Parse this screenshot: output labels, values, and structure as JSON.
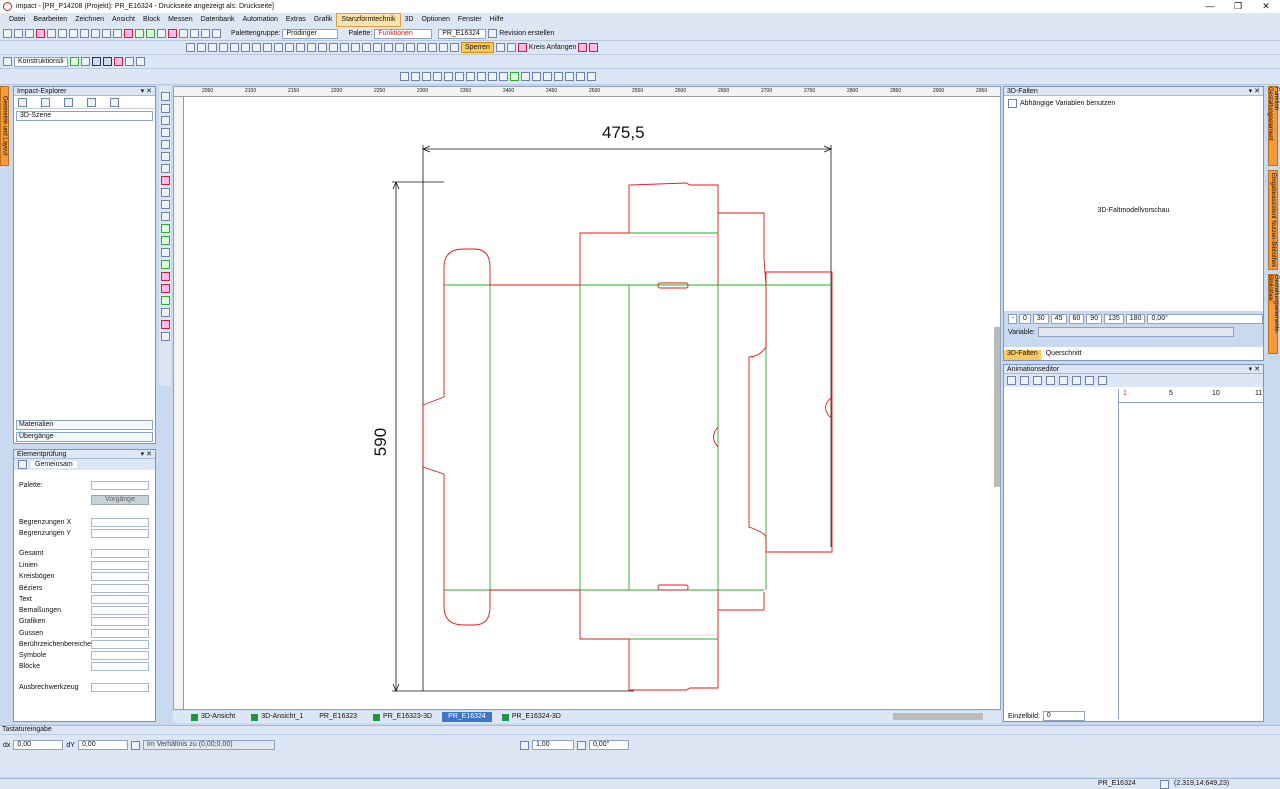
{
  "window": {
    "title": "impact - [PR_P14208 (Projekt): PR_E16324 - Druckseite angezeigt als: Druckseite]",
    "controls": [
      "—",
      "❐",
      "✕"
    ]
  },
  "menu": [
    "Datei",
    "Bearbeiten",
    "Zeichnen",
    "Ansicht",
    "Block",
    "Messen",
    "Datenbank",
    "Automation",
    "Extras",
    "Grafik",
    "Stanzformtechnik",
    "3D",
    "Optionen",
    "Fenster",
    "Hilfe"
  ],
  "menu_active": "Stanzformtechnik",
  "toolbar1": {
    "palettengruppe_label": "Palettengruppe:",
    "palettengruppe_value": "Prodinger",
    "palette_label": "Palette:",
    "palette_value": "Funktionen",
    "file_value": "PR_E16324",
    "revision_label": "Revision erstellen"
  },
  "toolbar2": {
    "sperren_label": "Sperren",
    "kreis_label": "Kreis Anfangen"
  },
  "toolbar3": {
    "layer_value": "Konstruktionsli"
  },
  "left_tab": "Geometrie und Layout",
  "explorer": {
    "title": "Impact-Explorer",
    "scene_value": "3D-Szene",
    "materialien": "Materialien",
    "uebergaenge": "Übergänge"
  },
  "element": {
    "title": "Elementprüfung",
    "tab": "Gemeinsam",
    "palette_label": "Palette:",
    "vorgaenge_label": "Vorgänge",
    "rows1": [
      "Begrenzungen X",
      "Begrenzungen Y"
    ],
    "rows2": [
      "Gesamt",
      "Linien",
      "Kreisbögen",
      "Béziers",
      "Text",
      "Bemaßungen",
      "Grafiken",
      "Gussen",
      "Berührzeichenbereiche",
      "Symbole",
      "Blöcke"
    ],
    "ausbrech": "Ausbrechwerkzeug"
  },
  "ruler_ticks": [
    "2050",
    "2100",
    "2150",
    "2200",
    "2250",
    "2300",
    "2350",
    "2400",
    "2450",
    "2500",
    "2550",
    "2600",
    "2650",
    "2700",
    "2750",
    "2800",
    "2850",
    "2900",
    "2950",
    "3000"
  ],
  "drawing": {
    "width_dim": "475,5",
    "height_dim": "590"
  },
  "tabs": [
    {
      "label": "3D-Ansicht",
      "active": false
    },
    {
      "label": "3D-Ansicht_1",
      "active": false
    },
    {
      "label": "PR_E16323",
      "active": false
    },
    {
      "label": "PR_E16323-3D",
      "active": false
    },
    {
      "label": "PR_E16324",
      "active": true
    },
    {
      "label": "PR_E16324-3D",
      "active": false
    }
  ],
  "falten": {
    "title": "3D-Falten",
    "checkbox_label": "Abhängige Variablen benutzen",
    "preview": "3D-Faltmodellvorschau",
    "angles": [
      "0",
      "30",
      "45",
      "60",
      "90",
      "135",
      "180"
    ],
    "angle_value": "0,00°",
    "variable_label": "Variable:",
    "tabs": [
      "3D-Falten",
      "Querschnitt"
    ]
  },
  "anim": {
    "title": "Animationseditor",
    "ticks": [
      "1",
      "5",
      "10",
      "11"
    ],
    "einzelbild_label": "Einzelbild:",
    "einzelbild_value": "0"
  },
  "right_tabs": [
    "Funktion Gestaltungselement",
    "Eingabeassistent Nutzen-Bibliothek",
    "Gestaltungselemente-Bibliothek"
  ],
  "tastatur": {
    "title": "Tastatureingabe",
    "dx_label": "dx",
    "dx_value": "0,00",
    "dy_label": "dY",
    "dy_value": "0,00",
    "verhaeltnis": "Im Verhältnis zu (0,00;0,00)",
    "line_value": "1,00",
    "angle_value": "0,00°"
  },
  "status": {
    "file": "PR_E16324",
    "coords": "(2.319,14:649,23)"
  },
  "colors": {
    "cut": "#e01818",
    "crease": "#20b020",
    "accent": "#f29a3c"
  }
}
